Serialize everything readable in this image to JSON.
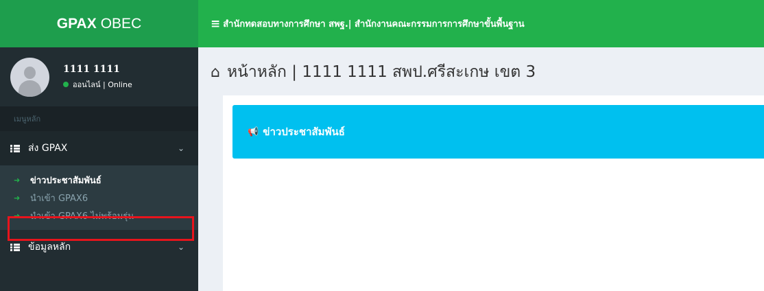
{
  "brand": {
    "bold": "GPAX",
    "light": "OBEC"
  },
  "topbar": {
    "title": "สำนักทดสอบทางการศึกษา สพฐ.| สำนักงานคณะกรรมการการศึกษาขั้นพื้นฐาน"
  },
  "user": {
    "name": "1111 1111",
    "status": "ออนไลน์ | Online"
  },
  "sidebar": {
    "header": "เมนูหลัก",
    "menus": [
      {
        "label": "ส่ง GPAX",
        "icon": "list-icon",
        "expanded": true,
        "items": [
          {
            "label": "ข่าวประชาสัมพันธ์",
            "current": true
          },
          {
            "label": "นำเข้า GPAX6"
          },
          {
            "label": "นำเข้า GPAX6 ไม่พร้อมรุ่น"
          }
        ]
      },
      {
        "label": "ข้อมูลหลัก",
        "icon": "list-icon"
      }
    ]
  },
  "content": {
    "title": "หน้าหลัก | 1111 1111  สพป.ศรีสะเกษ เขต 3",
    "news_box": {
      "label": "ข่าวประชาสัมพันธ์"
    }
  },
  "colors": {
    "brand": "#1e9e4d",
    "topbar": "#22b14c",
    "sidebar": "#222d32",
    "info_box": "#00c0ef",
    "highlight": "#e8141c"
  }
}
